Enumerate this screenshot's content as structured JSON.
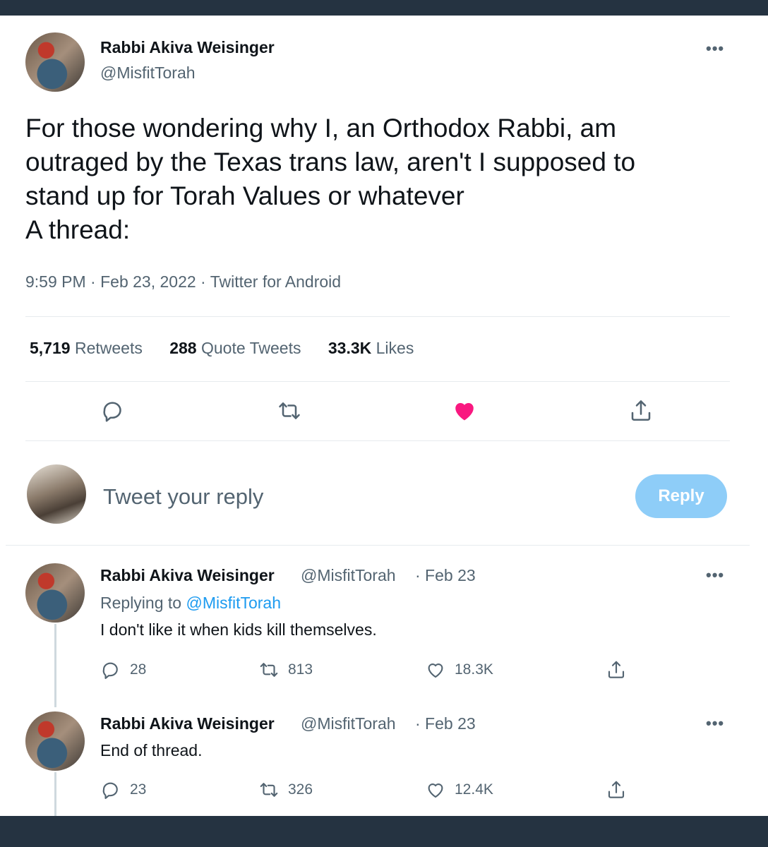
{
  "tweet": {
    "author_name": "Rabbi Akiva Weisinger",
    "author_handle": "@MisfitTorah",
    "more_label": "•••",
    "text_lines": [
      "For those wondering why I, an Orthodox Rabbi, am",
      "outraged by the Texas trans law, aren't I supposed to",
      "stand up for Torah Values or whatever",
      "A thread:"
    ],
    "time": "9:59 PM",
    "date": "Feb 23, 2022",
    "source": "Twitter for Android",
    "separator": " · ",
    "stats": {
      "retweets_count": "5,719",
      "retweets_label": "Retweets",
      "quotes_count": "288",
      "quotes_label": "Quote Tweets",
      "likes_count": "33.3K",
      "likes_label": "Likes"
    },
    "actions": {
      "reply_icon": "comment-icon",
      "retweet_icon": "retweet-icon",
      "like_icon": "heart-filled-icon",
      "share_icon": "share-icon",
      "like_color": "#f91880"
    }
  },
  "composer": {
    "placeholder": "Tweet your reply",
    "reply_button": "Reply",
    "button_color": "#8ecdf8"
  },
  "replies": [
    {
      "author_name": "Rabbi Akiva Weisinger",
      "author_handle": "@MisfitTorah",
      "date_text": "· Feb 23",
      "replying_prefix": "Replying to",
      "replying_handle": "@MisfitTorah",
      "text": "I don't like it when kids kill themselves.",
      "reply_count": "28",
      "retweet_count": "813",
      "like_count": "18.3K"
    },
    {
      "author_name": "Rabbi Akiva Weisinger",
      "author_handle": "@MisfitTorah",
      "date_text": "· Feb 23",
      "text": "End of thread.",
      "reply_count": "23",
      "retweet_count": "326",
      "like_count": "12.4K"
    }
  ],
  "colors": {
    "frame": "#253341",
    "text_primary": "#0f1419",
    "text_secondary": "#536471",
    "link": "#1d9bf0"
  }
}
